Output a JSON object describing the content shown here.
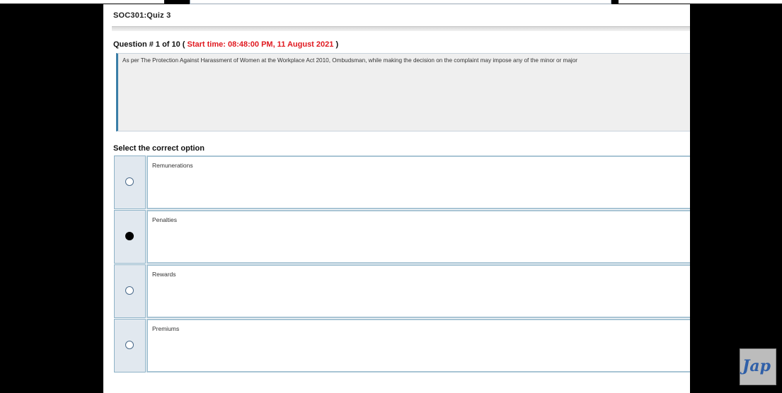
{
  "quiz_title": "SOC301:Quiz 3",
  "question": {
    "prefix": "Question # 1 of 10 (",
    "start_time": "Start time: 08:48:00 PM, 11 August 2021",
    "suffix": ")",
    "text": "As per The Protection Against Harassment of Women at the Workplace Act 2010, Ombudsman, while making the decision on the complaint may impose any of the minor or major"
  },
  "select_label": "Select the correct option",
  "options": [
    {
      "label": "Remunerations",
      "selected": false
    },
    {
      "label": "Penalties",
      "selected": true
    },
    {
      "label": "Rewards",
      "selected": false
    },
    {
      "label": "Premiums",
      "selected": false
    }
  ],
  "watermark": "Jap"
}
